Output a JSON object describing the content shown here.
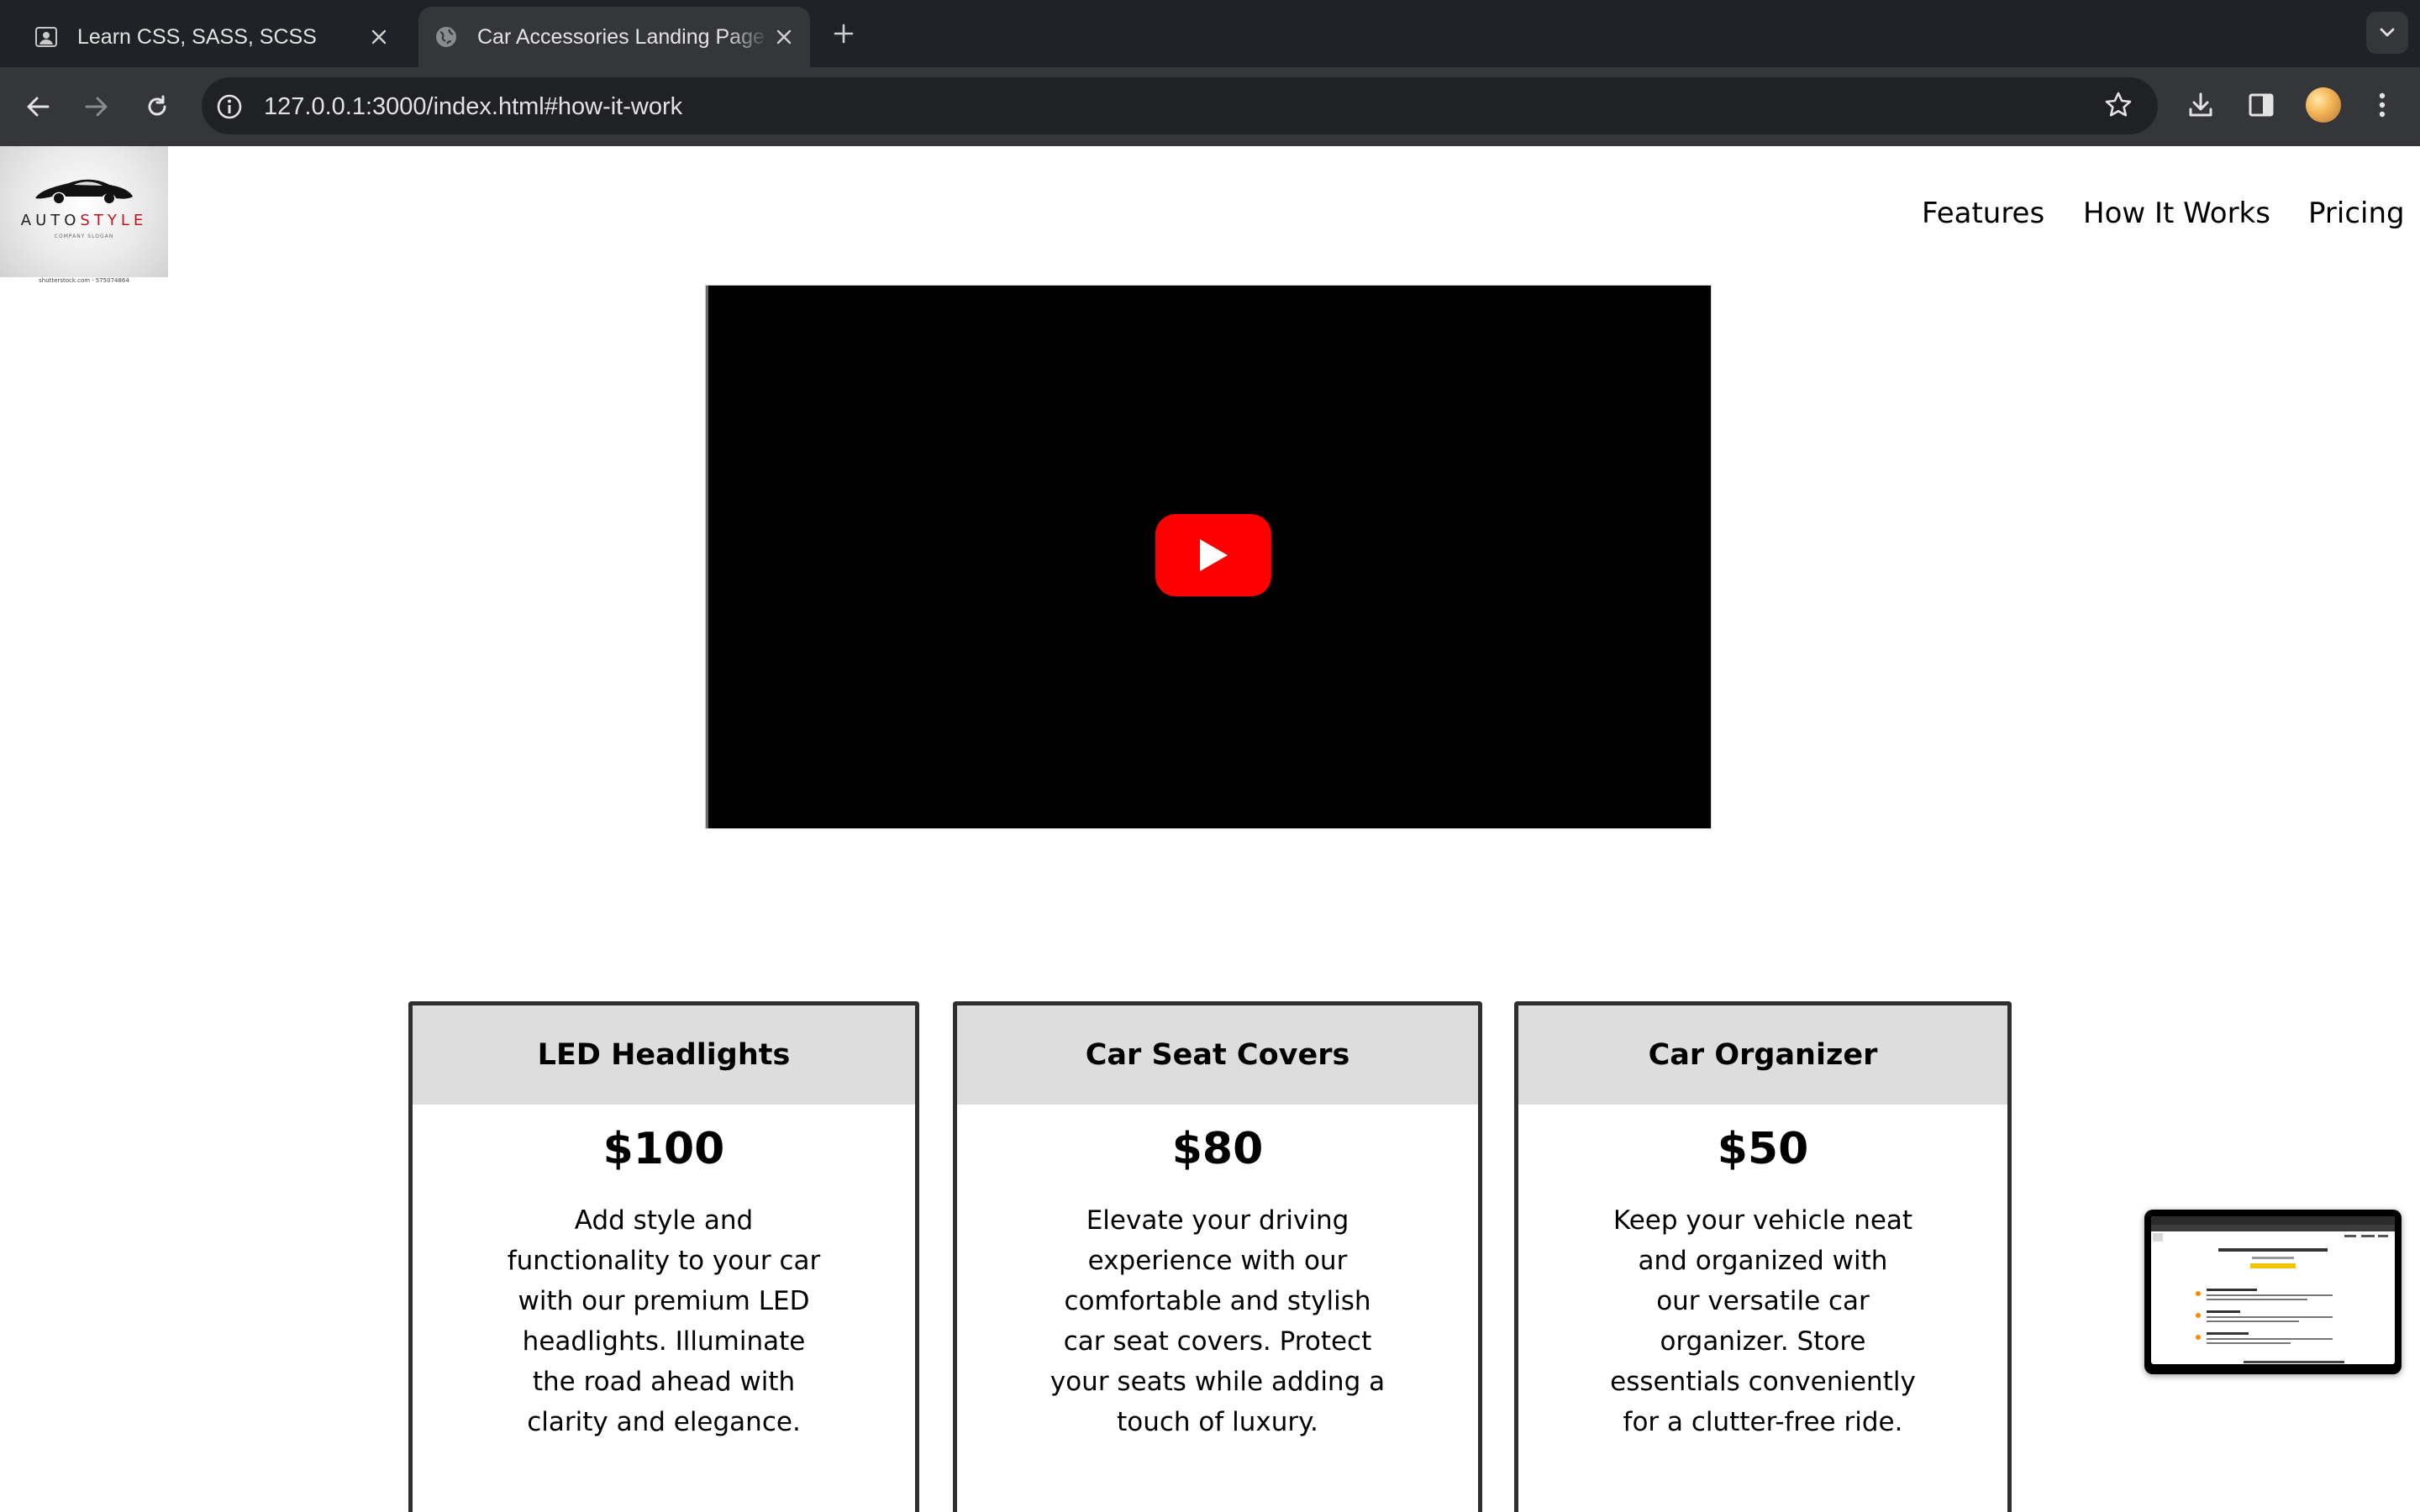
{
  "browser": {
    "tabs": [
      {
        "title": "Learn CSS, SASS, SCSS",
        "active": false,
        "favicon": "person-card-icon"
      },
      {
        "title": "Car Accessories Landing Page",
        "active": true,
        "favicon": "globe-icon"
      }
    ],
    "url": "127.0.0.1:3000/index.html#how-it-work"
  },
  "logo": {
    "brand_left": "AUTO",
    "brand_right": "STYLE",
    "tagline": "COMPANY SLOGAN",
    "credit": "shutterstock.com · 575074864"
  },
  "nav": {
    "links": [
      "Features",
      "How It Works",
      "Pricing"
    ]
  },
  "video": {
    "play_icon": "youtube-play-icon",
    "play_color": "#ff0000"
  },
  "pricing": {
    "cards": [
      {
        "title": "LED Headlights",
        "price": "$100",
        "desc_lines": [
          "Add style and",
          "functionality to your car",
          "with our premium LED",
          "headlights. Illuminate",
          "the road ahead with",
          "clarity and elegance."
        ]
      },
      {
        "title": "Car Seat Covers",
        "price": "$80",
        "desc_lines": [
          "Elevate your driving",
          "experience with our",
          "comfortable and stylish",
          "car seat covers. Protect",
          "your seats while adding a",
          "touch of luxury."
        ]
      },
      {
        "title": "Car Organizer",
        "price": "$50",
        "desc_lines": [
          "Keep your vehicle neat",
          "and organized with",
          "our versatile car",
          "organizer. Store",
          "essentials conveniently",
          "for a clutter-free ride."
        ]
      }
    ]
  },
  "colors": {
    "card_header_bg": "#dddddd",
    "card_border": "#2f2f2f",
    "chrome_dark": "#1f2328",
    "chrome_toolbar": "#35363a"
  }
}
